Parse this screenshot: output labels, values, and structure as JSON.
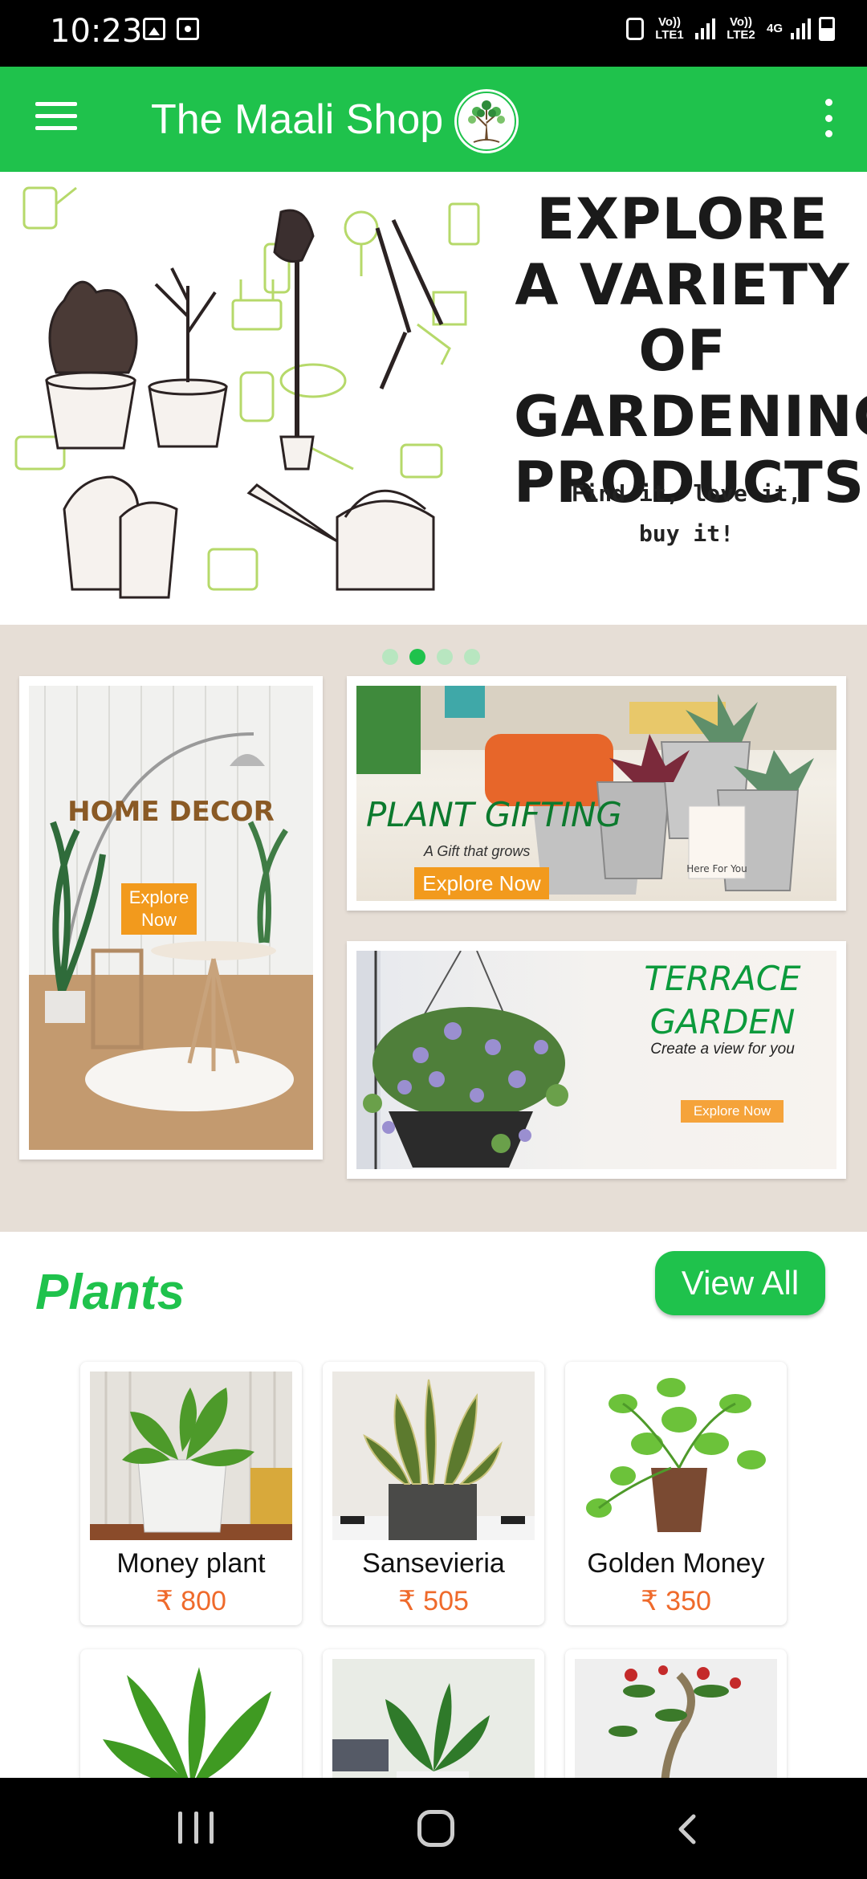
{
  "status_bar": {
    "time": "10:23",
    "sim1": "Vo)) LTE1",
    "sim2": "Vo)) LTE2",
    "net_type": "4G"
  },
  "app_bar": {
    "title": "The Maali Shop",
    "menu_icon": "hamburger-menu-icon",
    "more_icon": "more-vert-icon"
  },
  "hero": {
    "headline": "EXPLORE A VARIETY OF GARDENING PRODUCTS",
    "tagline": "Find it, love it, buy it!",
    "carousel_total": 4,
    "carousel_active": 2
  },
  "promos": {
    "home_decor": {
      "title": "HOME DECOR",
      "button": "Explore Now"
    },
    "plant_gifting": {
      "title": "PLANT GIFTING",
      "subtitle": "A Gift that grows",
      "button": "Explore Now",
      "card_text": "Here For You"
    },
    "terrace_garden": {
      "title": "TERRACE GARDEN",
      "subtitle": "Create a view for you",
      "button": "Explore Now"
    }
  },
  "plants": {
    "title": "Plants",
    "view_all": "View All",
    "items": [
      {
        "name": "Money plant",
        "price": "₹ 800"
      },
      {
        "name": "Sansevieria",
        "price": "₹ 505"
      },
      {
        "name": "Golden Money",
        "price": "₹ 350"
      }
    ]
  },
  "colors": {
    "brand_green": "#1fc24c",
    "accent_orange": "#f29a1d",
    "price_orange": "#ef6a2b"
  }
}
